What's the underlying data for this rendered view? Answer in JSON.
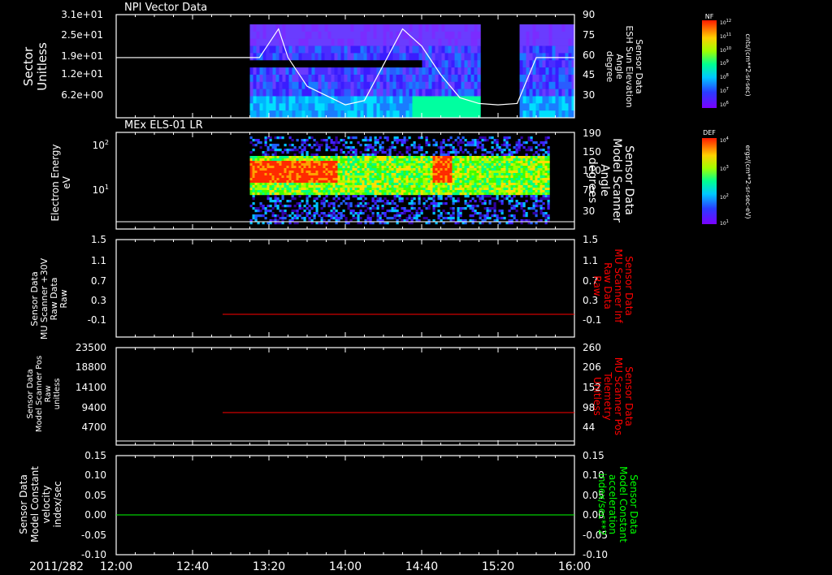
{
  "date_label": "2011/282",
  "x_ticks": [
    "12:00",
    "12:40",
    "13:20",
    "14:00",
    "14:40",
    "15:20",
    "16:00"
  ],
  "colors": {
    "frame": "#ffffff",
    "red": "#ff0000",
    "green": "#00ff00",
    "bg": "#000000"
  },
  "panels": [
    {
      "id": "npi",
      "title": "NPI Vector Data",
      "left_label": [
        "Sector",
        "Unitless"
      ],
      "left_ticks": [
        "3.1e+01",
        "2.5e+01",
        "1.9e+01",
        "1.2e+01",
        "6.2e+00"
      ],
      "right_label": [
        "Sensor Data",
        "ESH Sun Elevation",
        "Angle",
        "degree"
      ],
      "right_ticks": [
        "90",
        "75",
        "60",
        "45",
        "30"
      ],
      "colorbar": {
        "top_label": "NF",
        "unit": "cnts/(cm**2-sr-sec)",
        "ticks": [
          "10^12",
          "10^11",
          "10^10",
          "10^9",
          "10^8",
          "10^7",
          "10^6"
        ]
      }
    },
    {
      "id": "els",
      "title": "MEx ELS-01 LR",
      "left_label": [
        "Electron Energy",
        "eV"
      ],
      "left_ticks": [
        "10^2",
        "10^1"
      ],
      "right_label": [
        "Sensor Data",
        "Model Scanner",
        "Angle",
        "degrees"
      ],
      "right_ticks": [
        "190",
        "150",
        "110",
        "70",
        "30"
      ],
      "colorbar": {
        "top_label": "DEF",
        "unit": "ergs/(cm**2-sr-sec-eV)",
        "ticks": [
          "10^4",
          "10^3",
          "10^2",
          "10^1"
        ]
      }
    },
    {
      "id": "mu30",
      "left_label": [
        "Sensor Data",
        "MU Scanner +30V",
        "Raw Data",
        "Raw"
      ],
      "left_ticks": [
        "1.5",
        "1.1",
        "0.7",
        "0.3",
        "-0.1"
      ],
      "right_label": [
        "Sensor Data",
        "MU Scanner Inf",
        "Raw Data",
        "Raw"
      ],
      "right_ticks": [
        "1.5",
        "1.1",
        "0.7",
        "0.3",
        "-0.1"
      ]
    },
    {
      "id": "mupos",
      "left_label": [
        "Sensor Data",
        "Model Scanner Pos",
        "Raw",
        "unitless"
      ],
      "left_ticks": [
        "23500",
        "18800",
        "14100",
        "9400",
        "4700"
      ],
      "right_label": [
        "Sensor Data",
        "MU Scanner Pos",
        "Telemetry",
        "Unitless"
      ],
      "right_ticks": [
        "260",
        "206",
        "152",
        "98",
        "44"
      ]
    },
    {
      "id": "model",
      "left_label": [
        "Sensor Data",
        "Model Constant",
        "velocity",
        "index/sec"
      ],
      "left_ticks": [
        "0.15",
        "0.10",
        "0.05",
        "0.00",
        "-0.05",
        "-0.10"
      ],
      "right_label": [
        "Sensor Data",
        "Model Constant",
        "acceleration",
        "index/sec**2"
      ],
      "right_ticks": [
        "0.15",
        "0.10",
        "0.05",
        "0.00",
        "-0.05",
        "-0.10"
      ]
    }
  ],
  "chart_data": [
    {
      "type": "heatmap",
      "title": "NPI Vector Data",
      "xlabel": "",
      "ylabel": "Sector Unitless",
      "x_range": [
        "12:00",
        "16:00"
      ],
      "overlay_line": {
        "name": "ESH Sun Elevation Angle",
        "x": [
          "12:00",
          "13:00",
          "13:15",
          "13:25",
          "13:30",
          "13:40",
          "14:00",
          "14:10",
          "14:20",
          "14:30",
          "14:40",
          "14:50",
          "15:00",
          "15:10",
          "15:20",
          "15:30",
          "15:40",
          "16:00"
        ],
        "y": [
          60,
          60,
          60,
          80,
          60,
          40,
          27,
          30,
          55,
          80,
          68,
          48,
          32,
          28,
          27,
          28,
          60,
          60
        ]
      }
    },
    {
      "type": "heatmap",
      "title": "MEx ELS-01 LR",
      "xlabel": "",
      "ylabel": "Electron Energy eV",
      "x_range": [
        "12:00",
        "16:00"
      ],
      "overlay_line": {
        "name": "Model Scanner Angle",
        "x": [
          "12:00",
          "16:00"
        ],
        "y": [
          8,
          8
        ]
      }
    },
    {
      "type": "line",
      "series": [
        {
          "name": "MU Scanner +30V Raw",
          "x": [
            "13:10",
            "16:00"
          ],
          "values": [
            -0.02,
            -0.02
          ]
        }
      ],
      "ylim": [
        -0.3,
        1.5
      ]
    },
    {
      "type": "line",
      "series": [
        {
          "name": "Model Scanner Pos Raw",
          "x": [
            "13:10",
            "16:00"
          ],
          "values": [
            8000,
            8000
          ]
        }
      ],
      "ylim": [
        0,
        23500
      ]
    },
    {
      "type": "line",
      "series": [
        {
          "name": "Model Constant velocity",
          "x": [
            "12:00",
            "16:00"
          ],
          "values": [
            0.0,
            0.0
          ]
        }
      ],
      "ylim": [
        -0.1,
        0.15
      ]
    }
  ]
}
